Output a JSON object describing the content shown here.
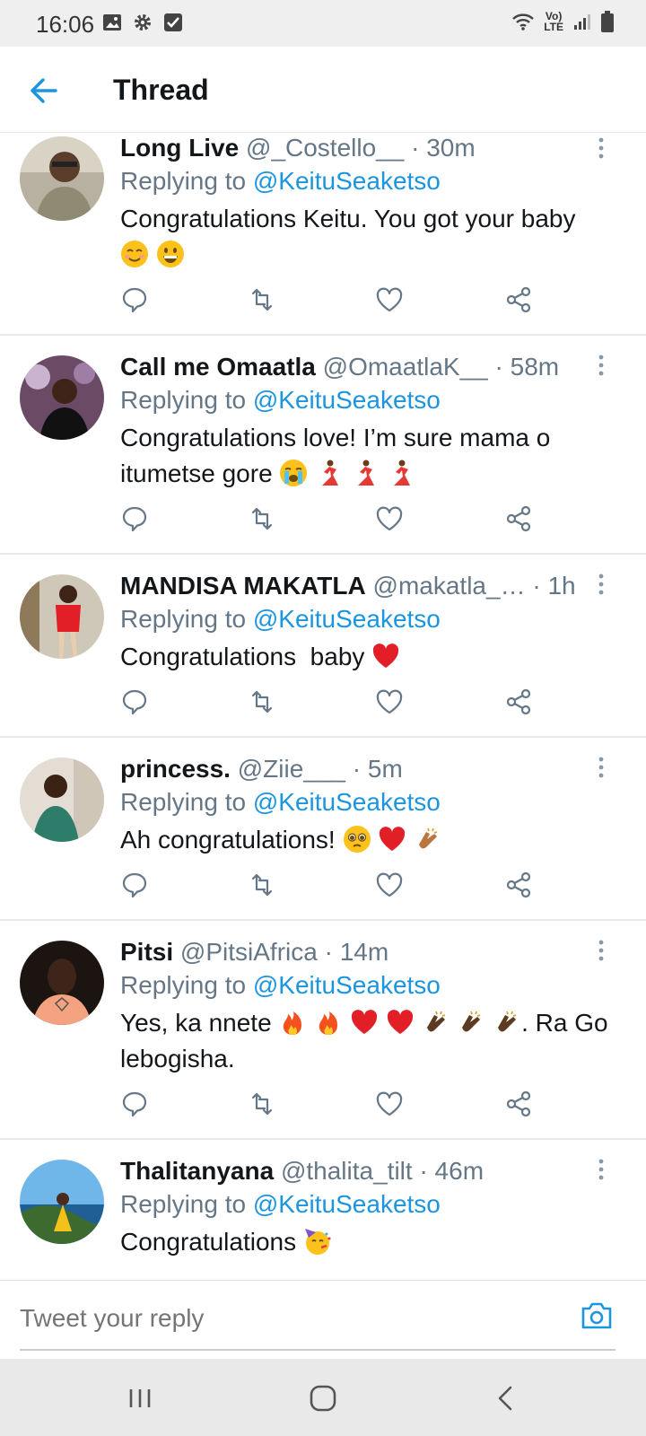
{
  "status_bar": {
    "time": "16:06",
    "left_icons": [
      "image-icon",
      "gear-icon",
      "check-box-icon"
    ],
    "right_icons": [
      "wifi-icon",
      "volte-icon",
      "signal-icon",
      "battery-icon"
    ],
    "volte_top": "Vo)",
    "volte_bottom": "LTE"
  },
  "header": {
    "title": "Thread",
    "back_icon": "back-arrow-icon"
  },
  "colors": {
    "accent": "#1b95e0",
    "text": "#14171a",
    "muted": "#657786"
  },
  "tweets": [
    {
      "name": "Long Live",
      "handle": "@_Costello__",
      "time": "· 30m",
      "replying_prefix": "Replying to ",
      "replying_to": "@KeituSeaketso",
      "text": "Congratulations Keitu. You got your baby",
      "emojis": [
        "relieved-face-emoji",
        "grinning-face-emoji"
      ]
    },
    {
      "name": "Call me Omaatla",
      "handle": "@OmaatlaK__",
      "time": "· 58m",
      "replying_prefix": "Replying to ",
      "replying_to": "@KeituSeaketso",
      "text": "Congratulations love! I’m sure mama o itumetse gore",
      "emojis": [
        "crying-face-emoji",
        "dancer-emoji",
        "dancer-emoji",
        "dancer-emoji"
      ]
    },
    {
      "name": "MANDISA MAKATLA",
      "handle": "@makatla_…",
      "time": "· 1h",
      "replying_prefix": "Replying to ",
      "replying_to": "@KeituSeaketso",
      "text": "Congratulations  baby",
      "emojis": [
        "red-heart-emoji"
      ]
    },
    {
      "name": "princess.",
      "handle": "@Ziie___",
      "time": "· 5m",
      "replying_prefix": "Replying to ",
      "replying_to": "@KeituSeaketso",
      "text": "Ah congratulations!",
      "emojis": [
        "pleading-face-emoji",
        "red-heart-emoji",
        "clapping-hands-emoji"
      ]
    },
    {
      "name": "Pitsi",
      "handle": "@PitsiAfrica",
      "time": "· 14m",
      "replying_prefix": "Replying to ",
      "replying_to": "@KeituSeaketso",
      "text_before": "Yes, ka nnete",
      "text_after": ". Ra Go lebogisha.",
      "emojis": [
        "fire-emoji",
        "fire-emoji",
        "red-heart-emoji",
        "red-heart-emoji",
        "clapping-hands-emoji",
        "clapping-hands-emoji",
        "clapping-hands-emoji"
      ]
    },
    {
      "name": "Thalitanyana",
      "handle": "@thalita_tilt",
      "time": "· 46m",
      "replying_prefix": "Replying to ",
      "replying_to": "@KeituSeaketso",
      "text": "Congratulations",
      "emojis": [
        "party-face-emoji"
      ]
    }
  ],
  "action_icons": [
    "reply-icon",
    "retweet-icon",
    "like-icon",
    "share-icon"
  ],
  "reply_bar": {
    "placeholder": "Tweet your reply",
    "camera_icon": "camera-icon"
  },
  "nav_bar": {
    "icons": [
      "recent-apps-icon",
      "home-icon",
      "back-icon"
    ]
  }
}
